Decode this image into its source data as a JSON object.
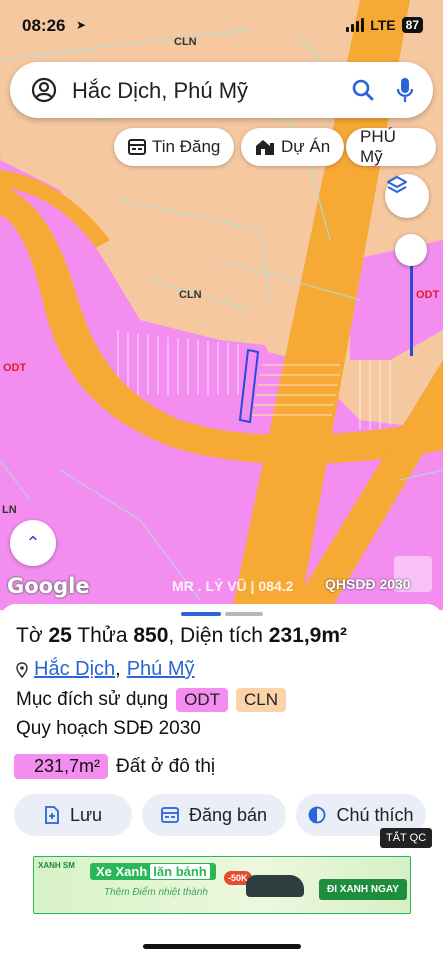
{
  "status": {
    "time": "08:26",
    "network": "LTE",
    "battery": "87"
  },
  "search": {
    "query": "Hắc Dịch, Phú Mỹ"
  },
  "chips": [
    {
      "label": "Tin Đăng",
      "icon": "listing-icon"
    },
    {
      "label": "Dự Án",
      "icon": "building-icon"
    },
    {
      "label": "PHÚ Mỹ"
    }
  ],
  "map": {
    "labels": {
      "cln_top": "CLN",
      "cln_mid": "CLN",
      "odt_left": "ODT",
      "odt_right": "ODT",
      "ln_left": "LN"
    },
    "google": "Google",
    "watermark": "MR . LÝ VŨ | 084.2",
    "layer_badge": "QHSDĐ 2030",
    "colors": {
      "residential": "#f38ef0",
      "road": "#f7a935",
      "agri": "#f6c8a0",
      "boundary": "#a9dfd8"
    }
  },
  "sheet": {
    "title_prefix": "Tờ ",
    "sheet_no": "25",
    "title_mid": " Thửa ",
    "parcel_no": "850",
    "title_area_label": ", Diện tích ",
    "area": "231,9m²",
    "location": {
      "ward": "Hắc Dịch",
      "sep": ",",
      "district": "Phú Mỹ"
    },
    "purpose_label": "Mục đích sử dụng",
    "purpose_tags": [
      "ODT",
      "CLN"
    ],
    "plan_label": "Quy hoạch SDĐ 2030",
    "plan_area": "231,7m²",
    "plan_use": "Đất ở đô thị",
    "actions": [
      {
        "label": "Lưu",
        "icon": "save-add-icon"
      },
      {
        "label": "Đăng bán",
        "icon": "listing-icon"
      },
      {
        "label": "Chú thích",
        "icon": "legend-icon"
      }
    ],
    "ad_close": "TẮT QC",
    "ad": {
      "brand": "XANH SM",
      "headline_a": "Xe Xanh",
      "headline_b": "lăn bánh",
      "sub": "Thêm Điểm nhiệt thành",
      "badge": "-50K",
      "cta": "ĐI XANH NGAY"
    }
  }
}
